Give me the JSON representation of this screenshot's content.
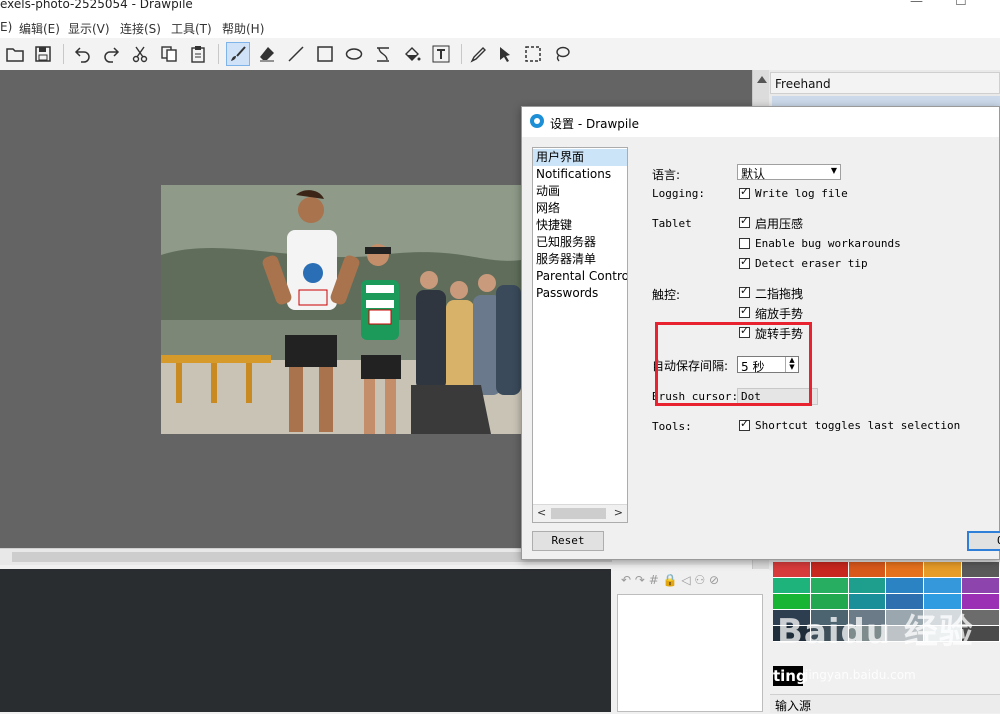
{
  "window": {
    "title": "exels-photo-2525054 - Drawpile",
    "min": "—",
    "max": "☐"
  },
  "menu": [
    "E)",
    "编辑(E)",
    "显示(V)",
    "连接(S)",
    "工具(T)",
    "帮助(H)"
  ],
  "toolbar": {
    "icons": [
      "folder-open-icon",
      "save-icon",
      "undo-icon",
      "redo-icon",
      "cut-icon",
      "copy-icon",
      "paste-icon",
      "brush-icon",
      "eraser-icon",
      "line-icon",
      "rectangle-icon",
      "ellipse-icon",
      "curve-icon",
      "fill-bucket-icon",
      "text-icon",
      "color-picker-icon",
      "selection-arrow-icon",
      "rect-select-icon",
      "lasso-icon"
    ],
    "active": "brush-icon"
  },
  "dock": {
    "tool_panel_title": "Freehand"
  },
  "dialog": {
    "title": "设置 - Drawpile",
    "categories": [
      "用户界面",
      "Notifications",
      "动画",
      "网络",
      "快捷键",
      "已知服务器",
      "服务器清单",
      "Parental Controls",
      "Passwords"
    ],
    "selected_category": "用户界面",
    "language": {
      "label": "语言:",
      "value": "默认"
    },
    "logging": {
      "label": "Logging:",
      "option": "Write log file",
      "checked": true
    },
    "tablet": {
      "label": "Tablet",
      "options": [
        {
          "text": "启用压感",
          "checked": true
        },
        {
          "text": "Enable bug workarounds",
          "checked": false
        },
        {
          "text": "Detect eraser tip",
          "checked": true
        }
      ]
    },
    "touch": {
      "label": "触控:",
      "options": [
        {
          "text": "二指拖拽",
          "checked": true
        },
        {
          "text": "缩放手势",
          "checked": true
        },
        {
          "text": "旋转手势",
          "checked": true
        }
      ]
    },
    "autosave": {
      "label": "自动保存间隔:",
      "value": "5 秒"
    },
    "brush_cursor": {
      "label": "Brush cursor:",
      "value": "Dot"
    },
    "tools": {
      "label": "Tools:",
      "option": "Shortcut toggles last selection",
      "checked": true
    },
    "reset_label": "Reset",
    "ok_label": "O"
  },
  "layers": {
    "toolbar_glyphs": "↶ ↷ # 🔒 ◁ ⚇ ⊘"
  },
  "palette": {
    "colors": [
      "#d83b3b",
      "#c8271f",
      "#d9591a",
      "#e5711d",
      "#e79c27",
      "#5a5a5a",
      "#1fb37c",
      "#27ae60",
      "#1e9e8c",
      "#2c83c4",
      "#3498db",
      "#8e44ad",
      "#18b535",
      "#22a84e",
      "#1a8f9a",
      "#2e6fb0",
      "#2f9be0",
      "#9b30b5",
      "#2c3e50",
      "#4b6470",
      "#6b7b87",
      "#9aa7ae",
      "#d4dadd",
      "#6c6c6c",
      "#1f2d3a",
      "#3f4f5a",
      "#7f8c8d",
      "#bdc3c7",
      "#ecf0f1",
      "#4a4a4a"
    ],
    "swatch_label": "ting"
  },
  "input_source": "输入源",
  "watermark": {
    "brand": "Baidu 经验",
    "url": "jingyan.baidu.com"
  }
}
